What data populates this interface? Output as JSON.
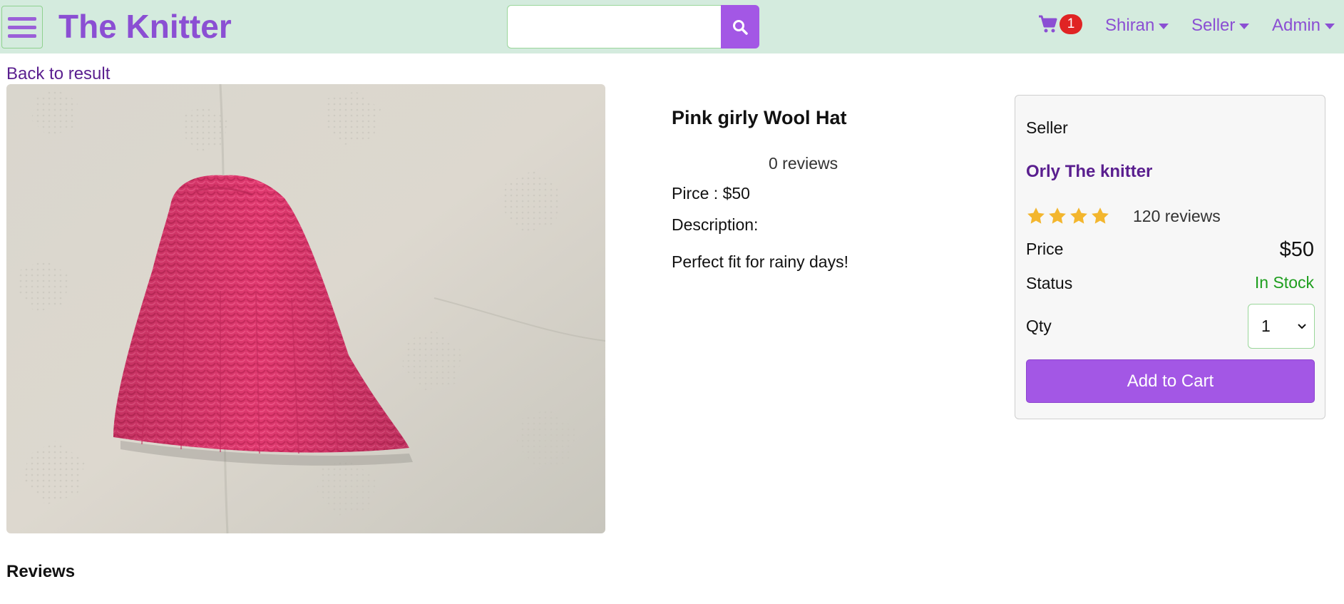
{
  "header": {
    "brand": "The Knitter",
    "search": {
      "value": "",
      "placeholder": ""
    },
    "cart_count": "1",
    "user_menu": "Shiran",
    "seller_menu": "Seller",
    "admin_menu": "Admin"
  },
  "back_link": "Back to result",
  "product": {
    "title": "Pink girly Wool Hat",
    "reviews": "0 reviews",
    "price_line": "Pirce : $50",
    "description_label": "Description:",
    "description": "Perfect fit for rainy days!"
  },
  "card": {
    "seller_label": "Seller",
    "seller_name": "Orly The knitter",
    "rating_stars": 4,
    "reviews": "120 reviews",
    "price_label": "Price",
    "price": "$50",
    "status_label": "Status",
    "status": "In Stock",
    "qty_label": "Qty",
    "qty_value": "1",
    "add_to_cart": "Add to Cart"
  },
  "reviews_heading": "Reviews",
  "colors": {
    "header_bg": "#d4ebde",
    "brand_purple": "#8b4fd3",
    "button_purple": "#a357e5",
    "link_purple": "#5a1f8f",
    "in_stock_green": "#1e9e1e",
    "badge_red": "#e02424",
    "star_gold": "#f3b62e",
    "hat_pink": "#e23a73"
  },
  "icons": {
    "menu": "hamburger-icon",
    "search": "search-icon",
    "cart": "shopping-cart-icon",
    "star": "star-icon",
    "dropdown": "caret-down-icon"
  }
}
